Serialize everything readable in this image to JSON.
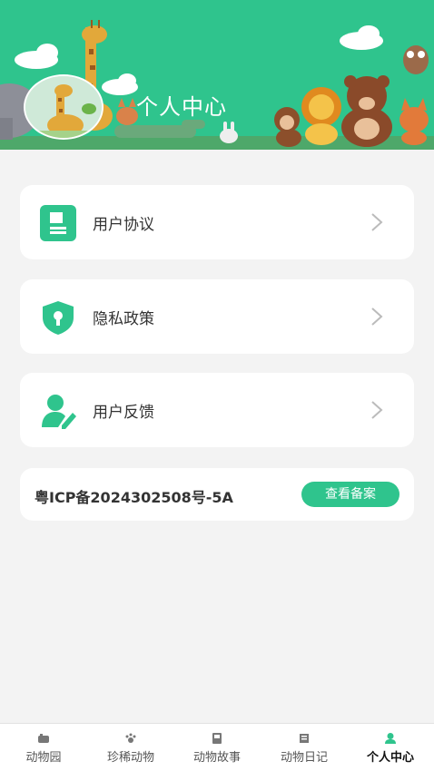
{
  "header": {
    "title": "个人中心"
  },
  "menu": [
    {
      "label": "用户协议",
      "icon": "document-icon"
    },
    {
      "label": "隐私政策",
      "icon": "shield-lock-icon"
    },
    {
      "label": "用户反馈",
      "icon": "user-edit-icon"
    }
  ],
  "icp": {
    "text": "粤ICP备2024302508号-5A",
    "button_label": "查看备案"
  },
  "tabbar": {
    "items": [
      {
        "label": "动物园",
        "icon": "zoo-icon"
      },
      {
        "label": "珍稀动物",
        "icon": "paw-icon"
      },
      {
        "label": "动物故事",
        "icon": "book-icon"
      },
      {
        "label": "动物日记",
        "icon": "diary-icon"
      },
      {
        "label": "个人中心",
        "icon": "person-icon"
      }
    ],
    "active_index": 4
  },
  "colors": {
    "accent": "#2fc48d",
    "background": "#f3f3f3",
    "card": "#ffffff",
    "text": "#333333"
  }
}
